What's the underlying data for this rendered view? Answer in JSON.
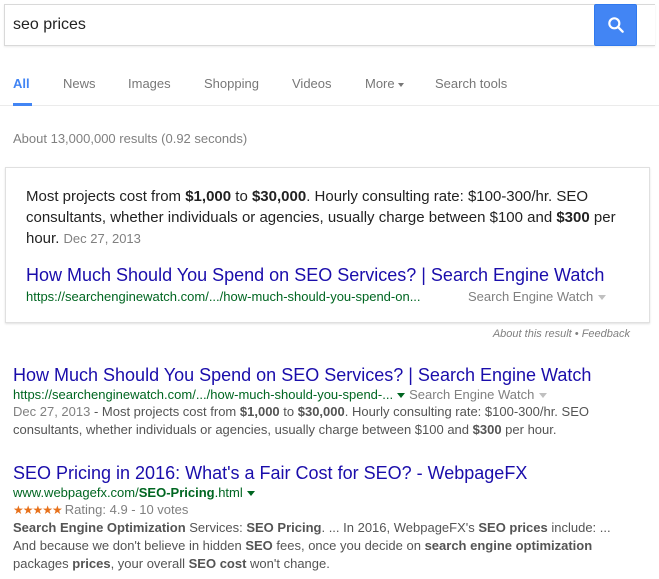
{
  "search": {
    "query": "seo prices"
  },
  "tabs": [
    {
      "label": "All"
    },
    {
      "label": "News"
    },
    {
      "label": "Images"
    },
    {
      "label": "Shopping"
    },
    {
      "label": "Videos"
    },
    {
      "label": "More"
    },
    {
      "label": "Search tools"
    }
  ],
  "stats": "About 13,000,000 results (0.92 seconds)",
  "featured_snippet": {
    "text_1": "Most projects cost from ",
    "bold_1": "$1,000",
    "text_2": " to ",
    "bold_2": "$30,000",
    "text_3": ". Hourly consulting rate: $100-300/hr. SEO consultants, whether individuals or agencies, usually charge between $100 and ",
    "bold_3": "$300",
    "text_4": " per hour.",
    "date": "Dec 27, 2013",
    "title": "How Much Should You Spend on SEO Services? | Search Engine Watch",
    "url": "https://searchenginewatch.com/.../how-much-should-you-spend-on...",
    "source": "Search Engine Watch"
  },
  "about": {
    "about_label": "About this result",
    "separator": " • ",
    "feedback_label": "Feedback"
  },
  "results": [
    {
      "title": "How Much Should You Spend on SEO Services? | Search Engine Watch",
      "url": "https://searchenginewatch.com/.../how-much-should-you-spend-...",
      "source": "Search Engine Watch",
      "date": "Dec 27, 2013",
      "desc_1": " - Most projects cost from ",
      "desc_b1": "$1,000",
      "desc_2": " to ",
      "desc_b2": "$30,000",
      "desc_3": ". Hourly consulting rate: $100-300/hr. SEO consultants, whether individuals or agencies, usually charge between $100 and ",
      "desc_b3": "$300",
      "desc_4": " per hour."
    },
    {
      "title": "SEO Pricing in 2016: What's a Fair Cost for SEO? - WebpageFX",
      "url_prefix": "www.webpagefx.com/",
      "url_bold": "SEO-Pricing",
      "url_suffix": ".html",
      "stars": "★★★★★",
      "rating_text": "Rating: 4.9 - 10 votes",
      "desc_b1": "Search Engine Optimization",
      "desc_1": " Services: ",
      "desc_b2": "SEO Pricing",
      "desc_2": ". ... In 2016, WebpageFX's ",
      "desc_b3": "SEO prices",
      "desc_3": " include: ... And because we don't believe in hidden ",
      "desc_b4": "SEO",
      "desc_4": " fees, once you decide on ",
      "desc_b5": "search engine optimization",
      "desc_5": " packages ",
      "desc_b6": "prices",
      "desc_6": ", your overall ",
      "desc_b7": "SEO cost",
      "desc_7": " won't change."
    }
  ],
  "colors": {
    "accent": "#4285f4",
    "link": "#1a0dab",
    "url": "#006621",
    "stars": "#e7711b"
  }
}
